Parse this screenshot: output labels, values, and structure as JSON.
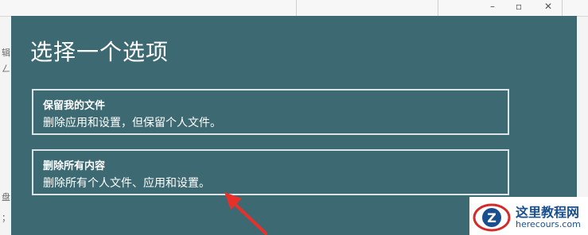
{
  "background_window": {
    "controls": [
      "–",
      "▫",
      "✕"
    ],
    "side_glyphs": [
      "辑",
      "ㄥ",
      "盘",
      "；"
    ]
  },
  "dialog": {
    "title": "选择一个选项",
    "options": [
      {
        "title": "保留我的文件",
        "description": "删除应用和设置，但保留个人文件。"
      },
      {
        "title": "删除所有内容",
        "description": "删除所有个人文件、应用和设置。"
      }
    ]
  },
  "annotation": {
    "arrow_color": "#e8302a"
  },
  "watermark": {
    "logo_letter": "Z",
    "title": "这里教程网",
    "url": "herecours.com"
  },
  "colors": {
    "dialog_bg": "#3d6a72",
    "option_border": "#d9e4e6"
  }
}
